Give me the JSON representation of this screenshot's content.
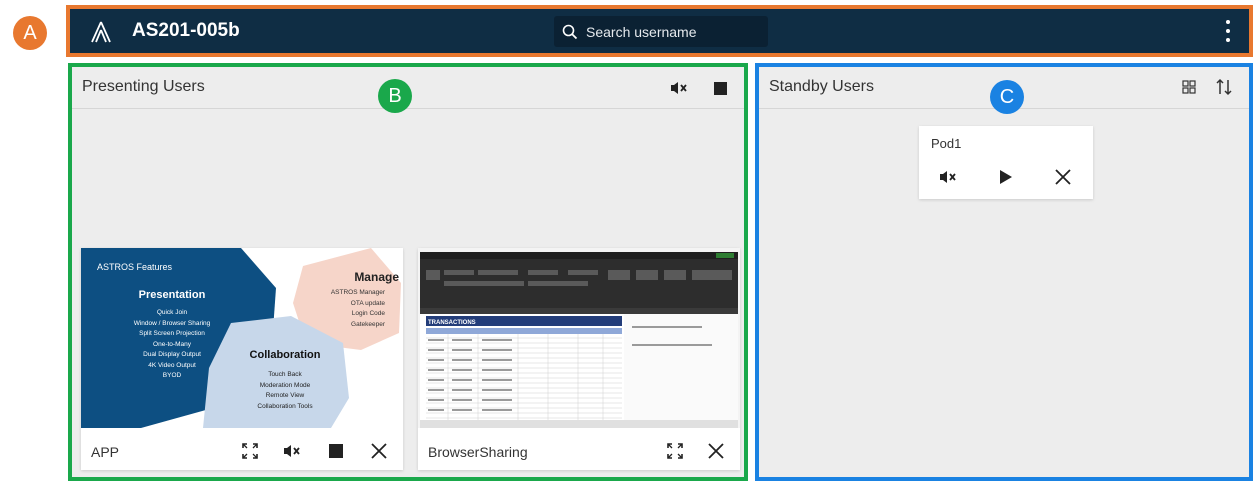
{
  "callouts": {
    "a": "A",
    "b": "B",
    "c": "C"
  },
  "colors": {
    "header_bg": "#0f2d44",
    "accent_orange": "#e8782f",
    "accent_green": "#1aa84b",
    "accent_blue": "#1a82e2"
  },
  "header": {
    "title": "AS201-005b",
    "search_placeholder": "Search username",
    "icons": [
      "logo-icon",
      "search-icon",
      "more-vert-icon"
    ]
  },
  "presenting": {
    "title": "Presenting Users",
    "header_icons": [
      "mute-icon",
      "stop-icon"
    ],
    "cards": [
      {
        "label": "APP",
        "actions": [
          "fullscreen-icon",
          "mute-icon",
          "stop-icon",
          "close-icon"
        ],
        "thumbnail": {
          "heading": "ASTROS Features",
          "presentation": {
            "title": "Presentation",
            "items": [
              "Quick Join",
              "Window / Browser Sharing",
              "Split Screen Projection",
              "One-to-Many",
              "Dual Display Output",
              "4K Video Output",
              "BYOD"
            ]
          },
          "manage": {
            "title": "Manage",
            "items": [
              "ASTROS Manager",
              "OTA update",
              "Login Code",
              "Gatekeeper"
            ]
          },
          "collaboration": {
            "title": "Collaboration",
            "items": [
              "Touch Back",
              "Moderation Mode",
              "Remote View",
              "Collaboration Tools"
            ]
          }
        }
      },
      {
        "label": "BrowserSharing",
        "actions": [
          "fullscreen-icon",
          "close-icon"
        ],
        "thumbnail": {
          "sheet_title": "TRANSACTIONS"
        }
      }
    ]
  },
  "standby": {
    "title": "Standby Users",
    "header_icons": [
      "grid-view-icon",
      "sort-icon"
    ],
    "pods": [
      {
        "name": "Pod1",
        "actions": [
          "mute-icon",
          "play-icon",
          "close-icon"
        ]
      }
    ]
  }
}
